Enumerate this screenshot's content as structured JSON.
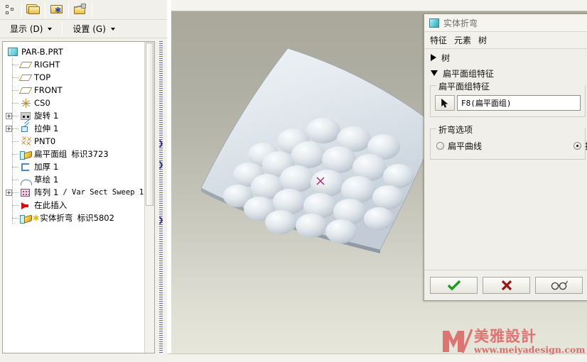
{
  "toolbar": {
    "icons": [
      {
        "name": "structure-dots-icon",
        "label": ""
      },
      {
        "name": "copy-folder-icon",
        "label": ""
      },
      {
        "name": "new-folder-icon",
        "label": ""
      },
      {
        "name": "edit-folder-icon",
        "label": ""
      }
    ]
  },
  "menubar": {
    "items": [
      {
        "name": "display-menu",
        "label": "显示 (D)"
      },
      {
        "name": "settings-menu",
        "label": "设置 (G)"
      }
    ]
  },
  "model_tree": {
    "nodes": [
      {
        "label": "PAR-B.PRT",
        "sub": "",
        "icon": "part-icon",
        "expander": "",
        "level": 0,
        "star": false
      },
      {
        "label": "RIGHT",
        "sub": "",
        "icon": "datum-plane-icon",
        "expander": "",
        "level": 1,
        "star": false
      },
      {
        "label": "TOP",
        "sub": "",
        "icon": "datum-plane-icon",
        "expander": "",
        "level": 1,
        "star": false
      },
      {
        "label": "FRONT",
        "sub": "",
        "icon": "datum-plane-icon",
        "expander": "",
        "level": 1,
        "star": false
      },
      {
        "label": "CS0",
        "sub": "",
        "icon": "coord-system-icon",
        "expander": "",
        "level": 1,
        "star": false
      },
      {
        "label": "旋转 1",
        "sub": "",
        "icon": "revolve-icon",
        "expander": "+",
        "level": 1,
        "star": false
      },
      {
        "label": "拉伸 1",
        "sub": "",
        "icon": "extrude-icon",
        "expander": "+",
        "level": 1,
        "star": false
      },
      {
        "label": "PNT0",
        "sub": "",
        "icon": "datum-point-icon",
        "expander": "",
        "level": 1,
        "star": false
      },
      {
        "label": "扁平面组",
        "sub": "标识3723",
        "icon": "flatten-quilt-icon",
        "expander": "",
        "level": 1,
        "star": false
      },
      {
        "label": "加厚 1",
        "sub": "",
        "icon": "thicken-icon",
        "expander": "",
        "level": 1,
        "star": false
      },
      {
        "label": "草绘 1",
        "sub": "",
        "icon": "sketch-icon",
        "expander": "",
        "level": 1,
        "star": false
      },
      {
        "label": "阵列 1",
        "sub": "/ Var Sect Sweep 1",
        "icon": "pattern-icon",
        "expander": "+",
        "level": 1,
        "star": false
      },
      {
        "label": "在此插入",
        "sub": "",
        "icon": "insert-here-icon",
        "expander": "",
        "level": 1,
        "star": false
      },
      {
        "label": "实体折弯",
        "sub": "标识5802",
        "icon": "solid-bend-icon",
        "expander": "",
        "level": 1,
        "star": true
      }
    ]
  },
  "dialog": {
    "title": "实体折弯",
    "menu": [
      {
        "name": "feature-menu",
        "label": "特征"
      },
      {
        "name": "element-menu",
        "label": "元素"
      },
      {
        "name": "tree-menu",
        "label": "树"
      }
    ],
    "sections": [
      {
        "name": "tree-section",
        "label": "树",
        "state": "collapsed"
      },
      {
        "name": "flatten-section",
        "label": "扁平面组特征",
        "state": "expanded"
      }
    ],
    "flatten_group": {
      "legend": "扁平面组特征",
      "selected_value": "F8(扁平面组)"
    },
    "bend_options": {
      "legend": "折弯选项",
      "options": [
        {
          "name": "flat-curve-radio",
          "label": "扁平曲线",
          "selected": false
        },
        {
          "name": "bend-curve-radio",
          "label": "折弯",
          "selected": true
        }
      ]
    },
    "footer": [
      {
        "name": "ok-button",
        "icon": "check-icon",
        "color": "#1a9b1a"
      },
      {
        "name": "cancel-button",
        "icon": "x-icon",
        "color": "#a01010"
      },
      {
        "name": "preview-button",
        "icon": "glasses-icon",
        "color": "#3a3a3a"
      }
    ]
  },
  "viewport": {
    "model_name": "curved-surface-with-dome-pattern",
    "datum_point_marker": "×",
    "background_top_color": "#a9a89a",
    "background_bottom_color": "#e8e7dc",
    "surface_color": "#dfe5ea"
  },
  "watermark": {
    "logo_letter": "M",
    "brand_cn": "美雅設計",
    "url": "www.meiyadesign.com",
    "color": "#d94a4a"
  }
}
